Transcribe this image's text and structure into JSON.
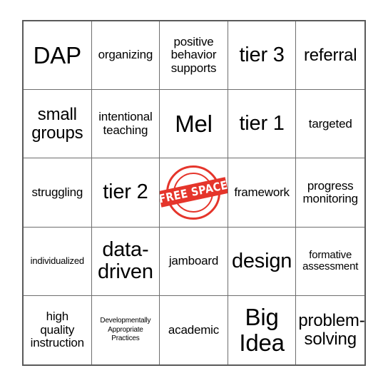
{
  "card": {
    "title": "Bingo Card",
    "columns": 5,
    "rows": 5,
    "grid_border_color": "#5a5a5a",
    "cell_border_color": "#6e6e6e",
    "background_color": "#ffffff",
    "text_color": "#000000"
  },
  "free_space": {
    "label": "FREE SPACE",
    "color": "#e5352b",
    "row": 3,
    "column": 3,
    "icon": "free-space-stamp-icon"
  },
  "cells": [
    {
      "id": "r1c1",
      "text": "DAP",
      "size": "fs-xxl"
    },
    {
      "id": "r1c2",
      "text": "organizing",
      "size": "fs-md"
    },
    {
      "id": "r1c3",
      "text": "positive\nbehavior\nsupports",
      "size": "fs-md"
    },
    {
      "id": "r1c4",
      "text": "tier 3",
      "size": "fs-xl"
    },
    {
      "id": "r1c5",
      "text": "referral",
      "size": "fs-lg"
    },
    {
      "id": "r2c1",
      "text": "small\ngroups",
      "size": "fs-lg"
    },
    {
      "id": "r2c2",
      "text": "intentional\nteaching",
      "size": "fs-md"
    },
    {
      "id": "r2c3",
      "text": "Mel",
      "size": "fs-xxl"
    },
    {
      "id": "r2c4",
      "text": "tier 1",
      "size": "fs-xl"
    },
    {
      "id": "r2c5",
      "text": "targeted",
      "size": "fs-md"
    },
    {
      "id": "r3c1",
      "text": "struggling",
      "size": "fs-md"
    },
    {
      "id": "r3c2",
      "text": "tier 2",
      "size": "fs-xl"
    },
    {
      "id": "r3c3",
      "text": "FREE SPACE",
      "size": "free"
    },
    {
      "id": "r3c4",
      "text": "framework",
      "size": "fs-md"
    },
    {
      "id": "r3c5",
      "text": "progress\nmonitoring",
      "size": "fs-md"
    },
    {
      "id": "r4c1",
      "text": "individualized",
      "size": "fs-xs"
    },
    {
      "id": "r4c2",
      "text": "data-\ndriven",
      "size": "fs-xl"
    },
    {
      "id": "r4c3",
      "text": "jamboard",
      "size": "fs-md"
    },
    {
      "id": "r4c4",
      "text": "design",
      "size": "fs-xl"
    },
    {
      "id": "r4c5",
      "text": "formative\nassessment",
      "size": "fs-sm"
    },
    {
      "id": "r5c1",
      "text": "high\nquality\ninstruction",
      "size": "fs-md"
    },
    {
      "id": "r5c2",
      "text": "Developmentally\nAppropriate\nPractices",
      "size": "fs-xxs"
    },
    {
      "id": "r5c3",
      "text": "academic",
      "size": "fs-md"
    },
    {
      "id": "r5c4",
      "text": "Big\nIdea",
      "size": "fs-xxl"
    },
    {
      "id": "r5c5",
      "text": "problem-\nsolving",
      "size": "fs-lg"
    }
  ]
}
